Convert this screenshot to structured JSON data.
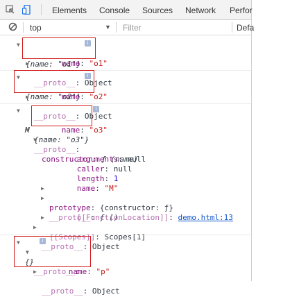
{
  "tabs": {
    "elements": "Elements",
    "console": "Console",
    "sources": "Sources",
    "network": "Network",
    "performance": "Perfor"
  },
  "filter": {
    "context": "top",
    "placeholder": "Filter",
    "levels": "Defa"
  },
  "info_glyph": "i",
  "entries": {
    "o1": {
      "preview": "{name: \"o1\"}",
      "name_key": "name",
      "name_value": "\"o1\"",
      "proto_key": "__proto__",
      "proto_value": "Object"
    },
    "o2": {
      "preview": "{name: \"o2\"}",
      "name_key": "name",
      "name_value": "\"o2\"",
      "proto_key": "__proto__",
      "proto_value": "Object"
    },
    "o3": {
      "class_name": "M",
      "preview": "{name: \"o3\"}",
      "name_key": "name",
      "name_value": "\"o3\"",
      "proto_key": "__proto__",
      "constructor_key": "constructor",
      "constructor_value": "ƒ (name)",
      "arguments_key": "arguments",
      "arguments_value": "null",
      "caller_key": "caller",
      "caller_value": "null",
      "length_key": "length",
      "length_value": "1",
      "fname_key": "name",
      "fname_value": "\"M\"",
      "prototype_key": "prototype",
      "prototype_value": "{constructor: ƒ}",
      "inner_proto_key": "__proto__",
      "inner_proto_value": "ƒ ()",
      "location_key": "[[FunctionLocation]]",
      "location_value": "demo.html:13",
      "scopes_key": "[[Scopes]]",
      "scopes_value": "Scopes[1]",
      "outer_proto_key": "__proto__",
      "outer_proto_value": "Object"
    },
    "p": {
      "preview": "{}",
      "proto_key": "__proto__",
      "name_key": "name",
      "name_value": "\"p\"",
      "inner_proto_key": "__proto__",
      "inner_proto_value": "Object"
    }
  }
}
